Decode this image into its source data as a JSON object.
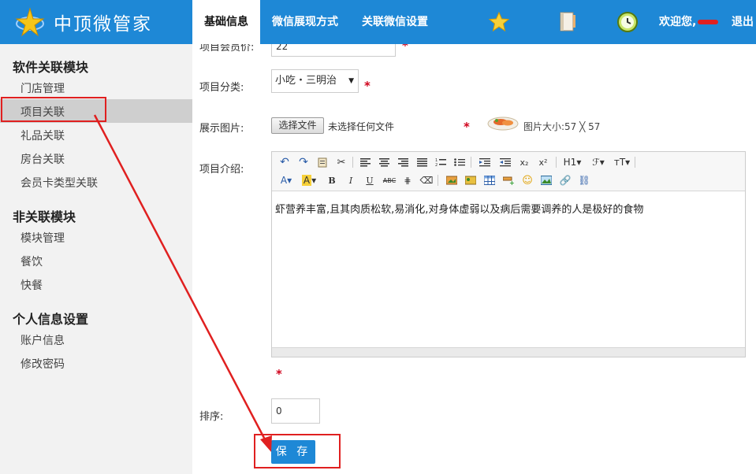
{
  "header": {
    "logo_text": "中顶微管家",
    "nav": [
      {
        "label": "基础信息",
        "active": true
      },
      {
        "label": "微信展现方式",
        "active": false
      },
      {
        "label": "关联微信设置",
        "active": false
      }
    ],
    "welcome": "欢迎您,",
    "logout": "退出"
  },
  "sidebar": {
    "sections": [
      {
        "title": "软件关联模块",
        "items": [
          "门店管理",
          "项目关联",
          "礼品关联",
          "房台关联",
          "会员卡类型关联"
        ]
      },
      {
        "title": "非关联模块",
        "items": [
          "模块管理",
          "餐饮",
          "快餐"
        ]
      },
      {
        "title": "个人信息设置",
        "items": [
          "账户信息",
          "修改密码"
        ]
      }
    ],
    "active_item": "项目关联"
  },
  "form": {
    "member_price_label": "项目会员价:",
    "member_price_value": "22",
    "category_label": "项目分类:",
    "category_value": "小吃・三明治",
    "image_label": "展示图片:",
    "file_button": "选择文件",
    "file_none": "未选择任何文件",
    "image_size": "图片大小:57 ╳ 57",
    "intro_label": "项目介绍:",
    "intro_text": "虾营养丰富,且其肉质松软,易消化,对身体虚弱以及病后需要调养的人是极好的食物",
    "sort_label": "排序:",
    "sort_value": "0",
    "save_button": "保 存",
    "required_mark": "*"
  },
  "colors": {
    "header": "#1e88d6",
    "required": "#d0021b",
    "annotation": "#e02020"
  }
}
